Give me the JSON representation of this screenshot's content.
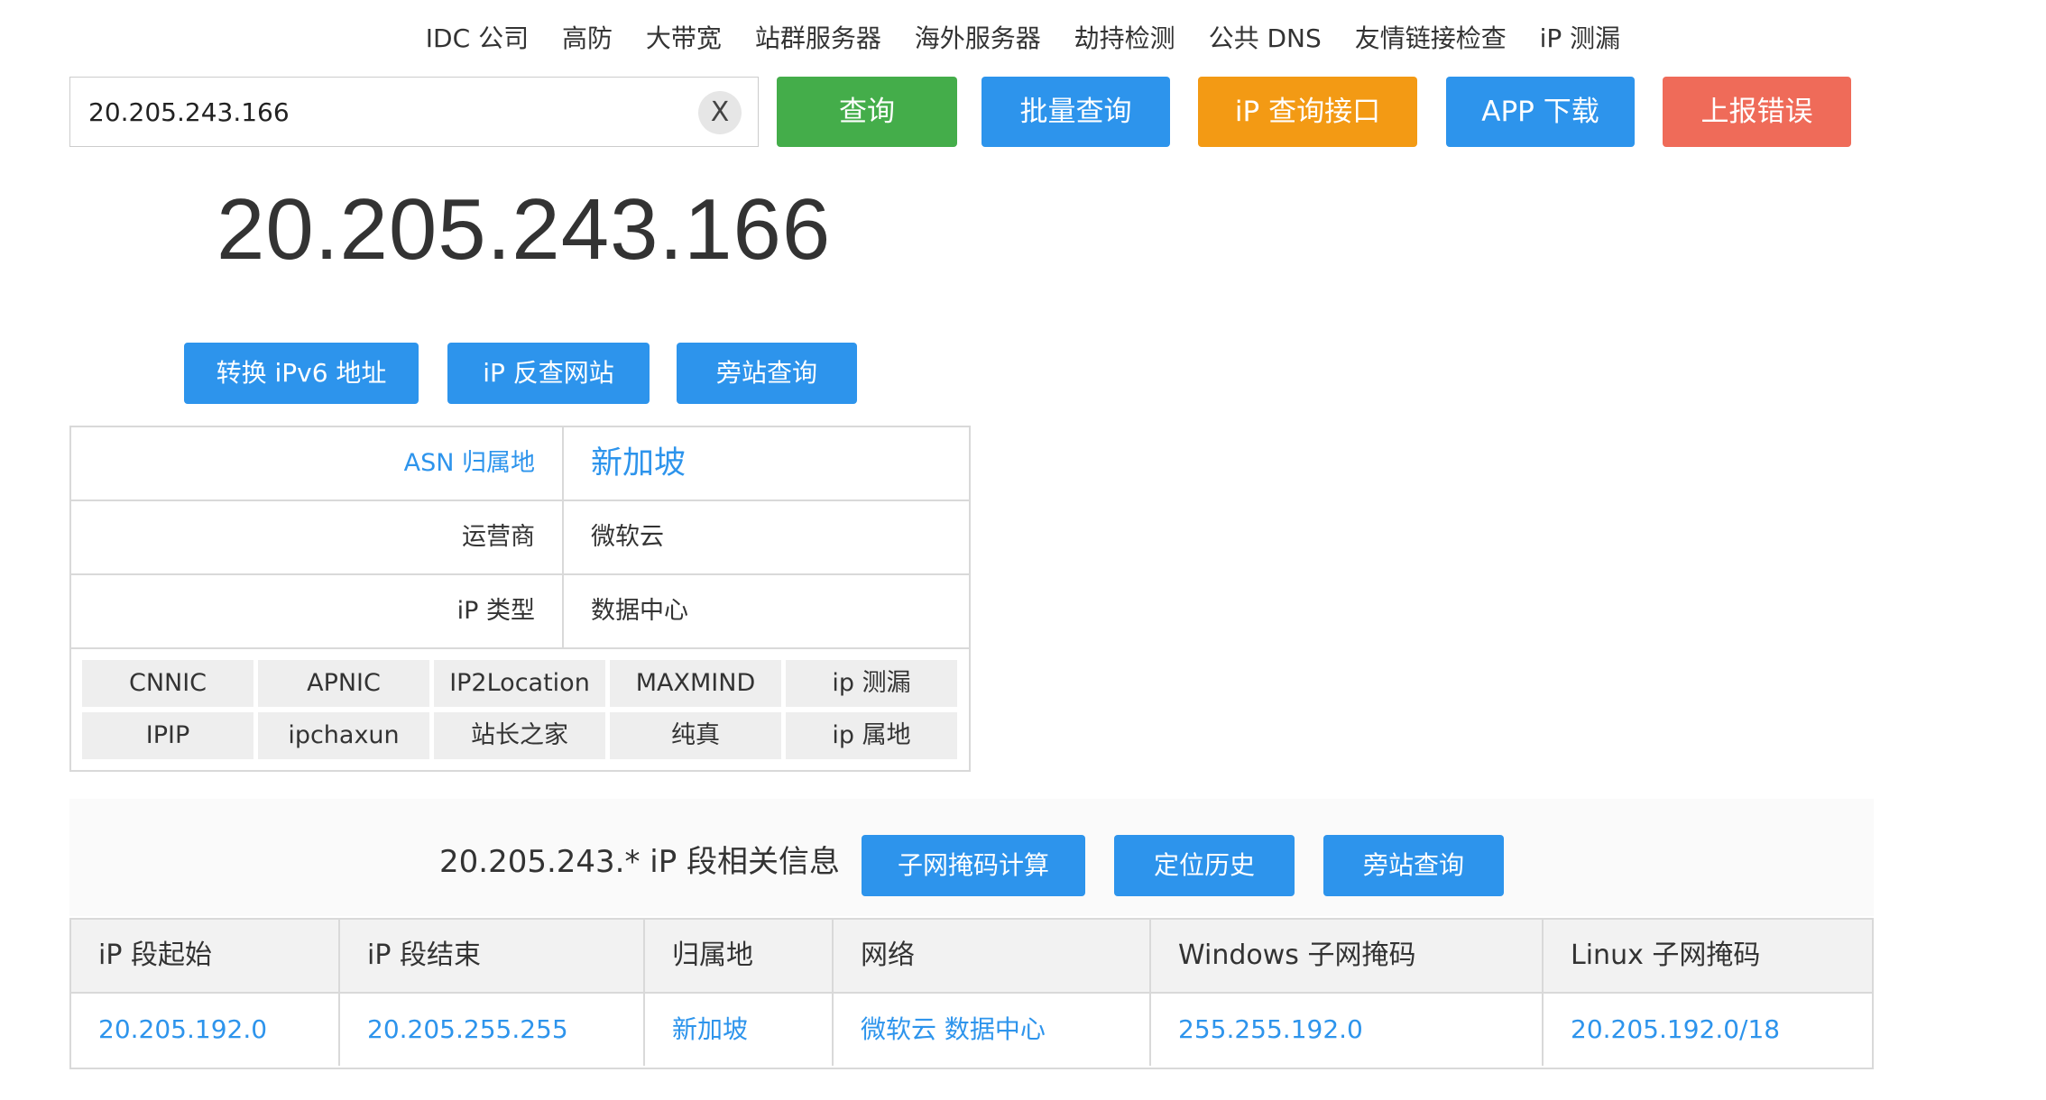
{
  "nav": {
    "items": [
      "IDC 公司",
      "高防",
      "大带宽",
      "站群服务器",
      "海外服务器",
      "劫持检测",
      "公共 DNS",
      "友情链接检查",
      "iP 测漏"
    ]
  },
  "search": {
    "value": "20.205.243.166",
    "clear_label": "X"
  },
  "actions": {
    "query": "查询",
    "batch_query": "批量查询",
    "api": "iP 查询接口",
    "app_download": "APP 下载",
    "report_error": "上报错误"
  },
  "result": {
    "ip": "20.205.243.166",
    "buttons": {
      "ipv6": "转换 iPv6 地址",
      "reverse": "iP 反查网站",
      "sibling": "旁站查询"
    },
    "rows": [
      {
        "key": "ASN 归属地",
        "value": "新加坡"
      },
      {
        "key": "运营商",
        "value": "微软云"
      },
      {
        "key": "iP 类型",
        "value": "数据中心"
      }
    ],
    "sources": [
      [
        "CNNIC",
        "APNIC",
        "IP2Location",
        "MAXMIND",
        "ip 测漏"
      ],
      [
        "IPIP",
        "ipchaxun",
        "站长之家",
        "纯真",
        "ip 属地"
      ]
    ]
  },
  "segment": {
    "title": "20.205.243.* iP 段相关信息",
    "buttons": {
      "subnet_calc": "子网掩码计算",
      "location_history": "定位历史",
      "sibling": "旁站查询"
    },
    "columns": [
      "iP 段起始",
      "iP 段结束",
      "归属地",
      "网络",
      "Windows 子网掩码",
      "Linux 子网掩码"
    ],
    "row": [
      "20.205.192.0",
      "20.205.255.255",
      "新加坡",
      "微软云 数据中心",
      "255.255.192.0",
      "20.205.192.0/18"
    ]
  },
  "colors": {
    "blue": "#2d94ec",
    "green": "#44ad4a",
    "orange": "#f39a14",
    "red": "#ef6b59"
  }
}
